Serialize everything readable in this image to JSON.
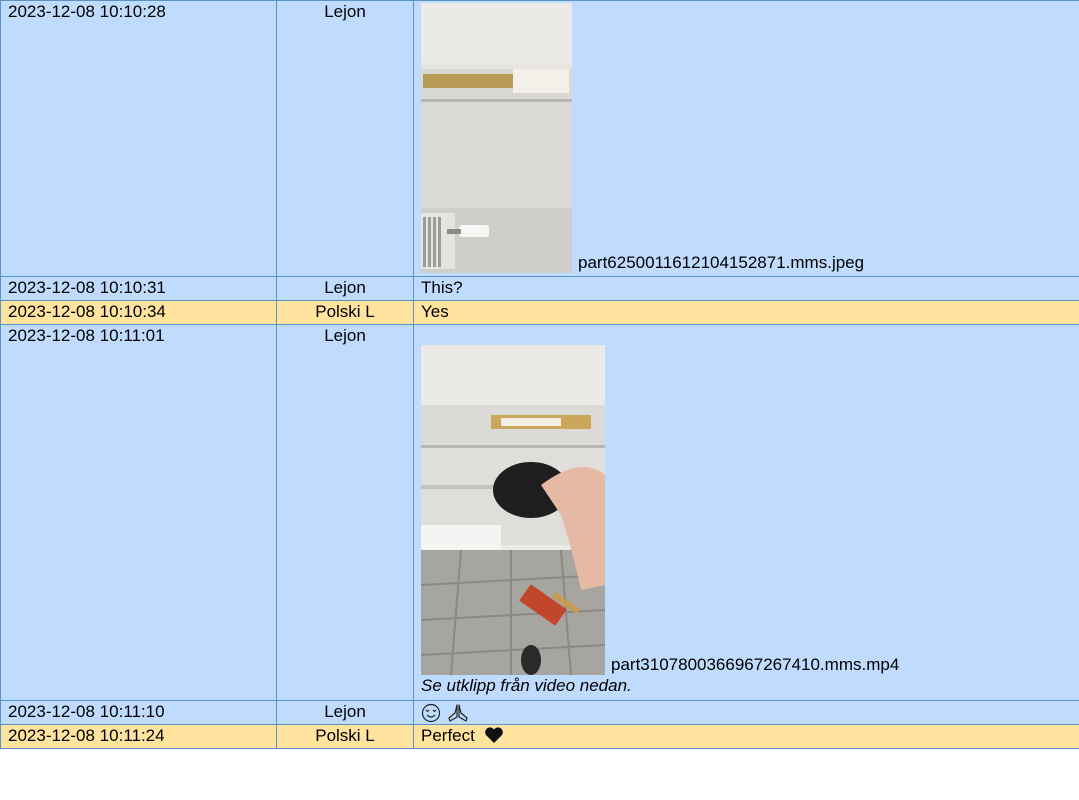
{
  "messages": [
    {
      "time": "2023-12-08 10:10:28",
      "sender": "Lejon",
      "attachment": "part6250011612104152871.mms.jpeg"
    },
    {
      "time": "2023-12-08 10:10:31",
      "sender": "Lejon",
      "text": "This?"
    },
    {
      "time": "2023-12-08 10:10:34",
      "sender": "Polski L",
      "text": "Yes"
    },
    {
      "time": "2023-12-08 10:11:01",
      "sender": "Lejon",
      "attachment": "part3107800366967267410.mms.mp4",
      "caption": "Se utklipp från video nedan."
    },
    {
      "time": "2023-12-08 10:11:10",
      "sender": "Lejon",
      "icons": [
        "smiling-face-with-heart-eyes-icon",
        "folded-hands-icon"
      ]
    },
    {
      "time": "2023-12-08 10:11:24",
      "sender": "Polski L",
      "text": "Perfect",
      "icon": "black-heart-icon"
    }
  ],
  "colors": {
    "sender_lejon_row": "#bfdcff",
    "sender_polski_row": "#ffe39e",
    "border": "#5b93c9"
  }
}
